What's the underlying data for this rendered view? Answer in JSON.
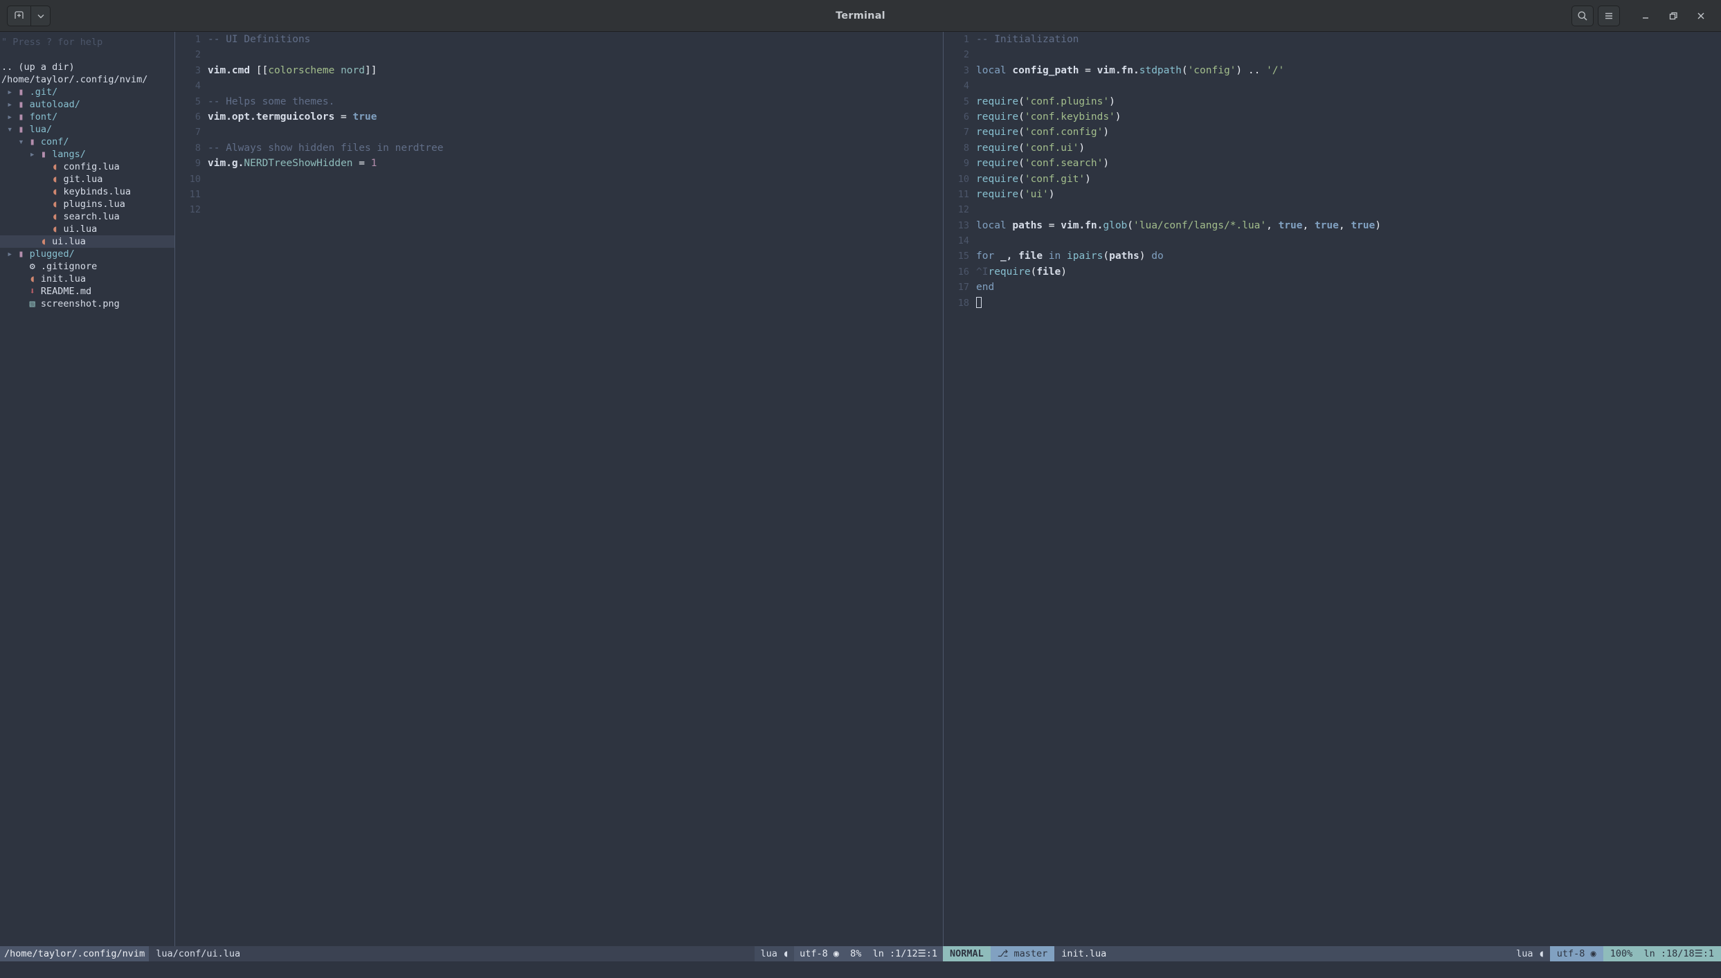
{
  "window": {
    "title": "Terminal",
    "new_tab_label": "+",
    "menu_label": "☰",
    "search_label": "⌕",
    "minimize_label": "–",
    "maximize_label": "❐",
    "close_label": "✕",
    "dropdown_label": "⌄"
  },
  "colors": {
    "background": "#2e3440",
    "foreground": "#d8dee9",
    "accent_cyan": "#8fbcbb",
    "accent_blue": "#81a1c1",
    "comment": "#616e88",
    "string": "#a3be8c",
    "number": "#b48ead",
    "headerbar": "#303336",
    "selection": "#3b4252",
    "divider": "#4c566a"
  },
  "sidebar": {
    "help_hint": "\" Press ? for help",
    "up_a_dir": ".. (up a dir)",
    "root_path": "/home/taylor/.config/nvim/",
    "items": [
      {
        "indent": 0,
        "arrow": "▸",
        "icon": "folder-icon",
        "glyph": "▮",
        "label": ".git/",
        "type": "dir",
        "selected": false
      },
      {
        "indent": 0,
        "arrow": "▸",
        "icon": "folder-icon",
        "glyph": "▮",
        "label": "autoload/",
        "type": "dir",
        "selected": false
      },
      {
        "indent": 0,
        "arrow": "▸",
        "icon": "folder-icon",
        "glyph": "▮",
        "label": "font/",
        "type": "dir",
        "selected": false
      },
      {
        "indent": 0,
        "arrow": "▾",
        "icon": "folder-icon",
        "glyph": "▮",
        "label": "lua/",
        "type": "dir",
        "selected": false
      },
      {
        "indent": 1,
        "arrow": "▾",
        "icon": "folder-icon",
        "glyph": "▮",
        "label": "conf/",
        "type": "dir",
        "selected": false
      },
      {
        "indent": 2,
        "arrow": "▸",
        "icon": "folder-icon",
        "glyph": "▮",
        "label": "langs/",
        "type": "dir",
        "selected": false
      },
      {
        "indent": 3,
        "arrow": "",
        "icon": "lua-file-icon",
        "glyph": "◖",
        "label": "config.lua",
        "type": "lua",
        "selected": false
      },
      {
        "indent": 3,
        "arrow": "",
        "icon": "lua-file-icon",
        "glyph": "◖",
        "label": "git.lua",
        "type": "lua",
        "selected": false
      },
      {
        "indent": 3,
        "arrow": "",
        "icon": "lua-file-icon",
        "glyph": "◖",
        "label": "keybinds.lua",
        "type": "lua",
        "selected": false
      },
      {
        "indent": 3,
        "arrow": "",
        "icon": "lua-file-icon",
        "glyph": "◖",
        "label": "plugins.lua",
        "type": "lua",
        "selected": false
      },
      {
        "indent": 3,
        "arrow": "",
        "icon": "lua-file-icon",
        "glyph": "◖",
        "label": "search.lua",
        "type": "lua",
        "selected": false
      },
      {
        "indent": 3,
        "arrow": "",
        "icon": "lua-file-icon",
        "glyph": "◖",
        "label": "ui.lua",
        "type": "lua",
        "selected": false
      },
      {
        "indent": 2,
        "arrow": "",
        "icon": "lua-file-icon",
        "glyph": "◖",
        "label": "ui.lua",
        "type": "lua",
        "selected": true
      },
      {
        "indent": 0,
        "arrow": "▸",
        "icon": "folder-icon",
        "glyph": "▮",
        "label": "plugged/",
        "type": "dir",
        "selected": false
      },
      {
        "indent": 1,
        "arrow": "",
        "icon": "gear-icon",
        "glyph": "⚙",
        "label": ".gitignore",
        "type": "cfg",
        "selected": false
      },
      {
        "indent": 1,
        "arrow": "",
        "icon": "lua-file-icon",
        "glyph": "◖",
        "label": "init.lua",
        "type": "lua",
        "selected": false
      },
      {
        "indent": 1,
        "arrow": "",
        "icon": "markdown-icon",
        "glyph": "⬇",
        "label": "README.md",
        "type": "md",
        "selected": false
      },
      {
        "indent": 1,
        "arrow": "",
        "icon": "image-file-icon",
        "glyph": "▧",
        "label": "screenshot.png",
        "type": "png",
        "selected": false
      }
    ]
  },
  "left_pane": {
    "filename": "lua/conf/ui.lua",
    "lines": [
      {
        "n": 1,
        "tokens": [
          {
            "t": "-- UI Definitions",
            "c": "c-comment"
          }
        ]
      },
      {
        "n": 2,
        "tokens": []
      },
      {
        "n": 3,
        "tokens": [
          {
            "t": "vim.cmd",
            "c": "c-ident"
          },
          {
            "t": " ",
            "c": ""
          },
          {
            "t": "[[",
            "c": "c-punct"
          },
          {
            "t": "colorscheme ",
            "c": "c-str"
          },
          {
            "t": "nord",
            "c": "c-field"
          },
          {
            "t": "]]",
            "c": "c-punct"
          }
        ]
      },
      {
        "n": 4,
        "tokens": []
      },
      {
        "n": 5,
        "tokens": [
          {
            "t": "-- Helps some themes.",
            "c": "c-comment"
          }
        ]
      },
      {
        "n": 6,
        "tokens": [
          {
            "t": "vim.opt.termguicolors",
            "c": "c-ident"
          },
          {
            "t": " = ",
            "c": "c-punct"
          },
          {
            "t": "true",
            "c": "c-bool"
          }
        ]
      },
      {
        "n": 7,
        "tokens": []
      },
      {
        "n": 8,
        "tokens": [
          {
            "t": "-- Always show hidden files in nerdtree",
            "c": "c-comment"
          }
        ]
      },
      {
        "n": 9,
        "tokens": [
          {
            "t": "vim.g.",
            "c": "c-ident"
          },
          {
            "t": "NERDTreeShowHidden",
            "c": "c-field"
          },
          {
            "t": " = ",
            "c": "c-punct"
          },
          {
            "t": "1",
            "c": "c-num"
          }
        ]
      },
      {
        "n": 10,
        "tokens": []
      },
      {
        "n": 11,
        "tokens": []
      },
      {
        "n": 12,
        "tokens": []
      }
    ]
  },
  "right_pane": {
    "filename": "init.lua",
    "lines": [
      {
        "n": 1,
        "tokens": [
          {
            "t": "-- Initialization",
            "c": "c-comment"
          }
        ]
      },
      {
        "n": 2,
        "tokens": []
      },
      {
        "n": 3,
        "tokens": [
          {
            "t": "local",
            "c": "c-kw"
          },
          {
            "t": " ",
            "c": ""
          },
          {
            "t": "config_path",
            "c": "c-ident"
          },
          {
            "t": " = ",
            "c": "c-punct"
          },
          {
            "t": "vim.fn.",
            "c": "c-ident"
          },
          {
            "t": "stdpath",
            "c": "c-func"
          },
          {
            "t": "(",
            "c": "c-punct"
          },
          {
            "t": "'config'",
            "c": "c-str"
          },
          {
            "t": ")",
            "c": "c-punct"
          },
          {
            "t": " .. ",
            "c": "c-punct"
          },
          {
            "t": "'/'",
            "c": "c-str"
          }
        ]
      },
      {
        "n": 4,
        "tokens": []
      },
      {
        "n": 5,
        "tokens": [
          {
            "t": "require",
            "c": "c-func"
          },
          {
            "t": "(",
            "c": "c-punct"
          },
          {
            "t": "'conf.plugins'",
            "c": "c-str"
          },
          {
            "t": ")",
            "c": "c-punct"
          }
        ]
      },
      {
        "n": 6,
        "tokens": [
          {
            "t": "require",
            "c": "c-func"
          },
          {
            "t": "(",
            "c": "c-punct"
          },
          {
            "t": "'conf.keybinds'",
            "c": "c-str"
          },
          {
            "t": ")",
            "c": "c-punct"
          }
        ]
      },
      {
        "n": 7,
        "tokens": [
          {
            "t": "require",
            "c": "c-func"
          },
          {
            "t": "(",
            "c": "c-punct"
          },
          {
            "t": "'conf.config'",
            "c": "c-str"
          },
          {
            "t": ")",
            "c": "c-punct"
          }
        ]
      },
      {
        "n": 8,
        "tokens": [
          {
            "t": "require",
            "c": "c-func"
          },
          {
            "t": "(",
            "c": "c-punct"
          },
          {
            "t": "'conf.ui'",
            "c": "c-str"
          },
          {
            "t": ")",
            "c": "c-punct"
          }
        ]
      },
      {
        "n": 9,
        "tokens": [
          {
            "t": "require",
            "c": "c-func"
          },
          {
            "t": "(",
            "c": "c-punct"
          },
          {
            "t": "'conf.search'",
            "c": "c-str"
          },
          {
            "t": ")",
            "c": "c-punct"
          }
        ]
      },
      {
        "n": 10,
        "tokens": [
          {
            "t": "require",
            "c": "c-func"
          },
          {
            "t": "(",
            "c": "c-punct"
          },
          {
            "t": "'conf.git'",
            "c": "c-str"
          },
          {
            "t": ")",
            "c": "c-punct"
          }
        ]
      },
      {
        "n": 11,
        "tokens": [
          {
            "t": "require",
            "c": "c-func"
          },
          {
            "t": "(",
            "c": "c-punct"
          },
          {
            "t": "'ui'",
            "c": "c-str"
          },
          {
            "t": ")",
            "c": "c-punct"
          }
        ]
      },
      {
        "n": 12,
        "tokens": []
      },
      {
        "n": 13,
        "tokens": [
          {
            "t": "local",
            "c": "c-kw"
          },
          {
            "t": " ",
            "c": ""
          },
          {
            "t": "paths",
            "c": "c-ident"
          },
          {
            "t": " = ",
            "c": "c-punct"
          },
          {
            "t": "vim.fn.",
            "c": "c-ident"
          },
          {
            "t": "glob",
            "c": "c-func"
          },
          {
            "t": "(",
            "c": "c-punct"
          },
          {
            "t": "'lua/conf/langs/*.lua'",
            "c": "c-str"
          },
          {
            "t": ", ",
            "c": "c-punct"
          },
          {
            "t": "true",
            "c": "c-bool"
          },
          {
            "t": ", ",
            "c": "c-punct"
          },
          {
            "t": "true",
            "c": "c-bool"
          },
          {
            "t": ", ",
            "c": "c-punct"
          },
          {
            "t": "true",
            "c": "c-bool"
          },
          {
            "t": ")",
            "c": "c-punct"
          }
        ]
      },
      {
        "n": 14,
        "tokens": []
      },
      {
        "n": 15,
        "tokens": [
          {
            "t": "for",
            "c": "c-kw"
          },
          {
            "t": " ",
            "c": ""
          },
          {
            "t": "_, ",
            "c": "c-ident"
          },
          {
            "t": "file",
            "c": "c-ident"
          },
          {
            "t": " ",
            "c": ""
          },
          {
            "t": "in",
            "c": "c-kw"
          },
          {
            "t": " ",
            "c": ""
          },
          {
            "t": "ipairs",
            "c": "c-func"
          },
          {
            "t": "(",
            "c": "c-punct"
          },
          {
            "t": "paths",
            "c": "c-ident"
          },
          {
            "t": ")",
            "c": "c-punct"
          },
          {
            "t": " ",
            "c": ""
          },
          {
            "t": "do",
            "c": "c-kw"
          }
        ]
      },
      {
        "n": 16,
        "tokens": [
          {
            "t": "^I",
            "c": "c-tab"
          },
          {
            "t": "require",
            "c": "c-func"
          },
          {
            "t": "(",
            "c": "c-punct"
          },
          {
            "t": "file",
            "c": "c-ident"
          },
          {
            "t": ")",
            "c": "c-punct"
          }
        ]
      },
      {
        "n": 17,
        "tokens": [
          {
            "t": "end",
            "c": "c-kw"
          }
        ]
      },
      {
        "n": 18,
        "tokens": [],
        "cursor": true
      }
    ]
  },
  "statusline_left": {
    "cwd": "/home/taylor/.config/nvim",
    "file": "lua/conf/ui.lua",
    "filetype": "lua",
    "filetype_icon": "◖",
    "encoding": "utf-8",
    "encoding_icon": "◉",
    "percent": "8%",
    "position": "ln :1/12",
    "column_icon": "☰",
    "column": ":1"
  },
  "statusline_right": {
    "mode": "NORMAL",
    "branch_icon": "⎇",
    "branch": "master",
    "file": "init.lua",
    "filetype": "lua",
    "filetype_icon": "◖",
    "encoding": "utf-8",
    "encoding_icon": "◉",
    "percent": "100%",
    "position": "ln :18/18",
    "column_icon": "☰",
    "column": ":1"
  }
}
